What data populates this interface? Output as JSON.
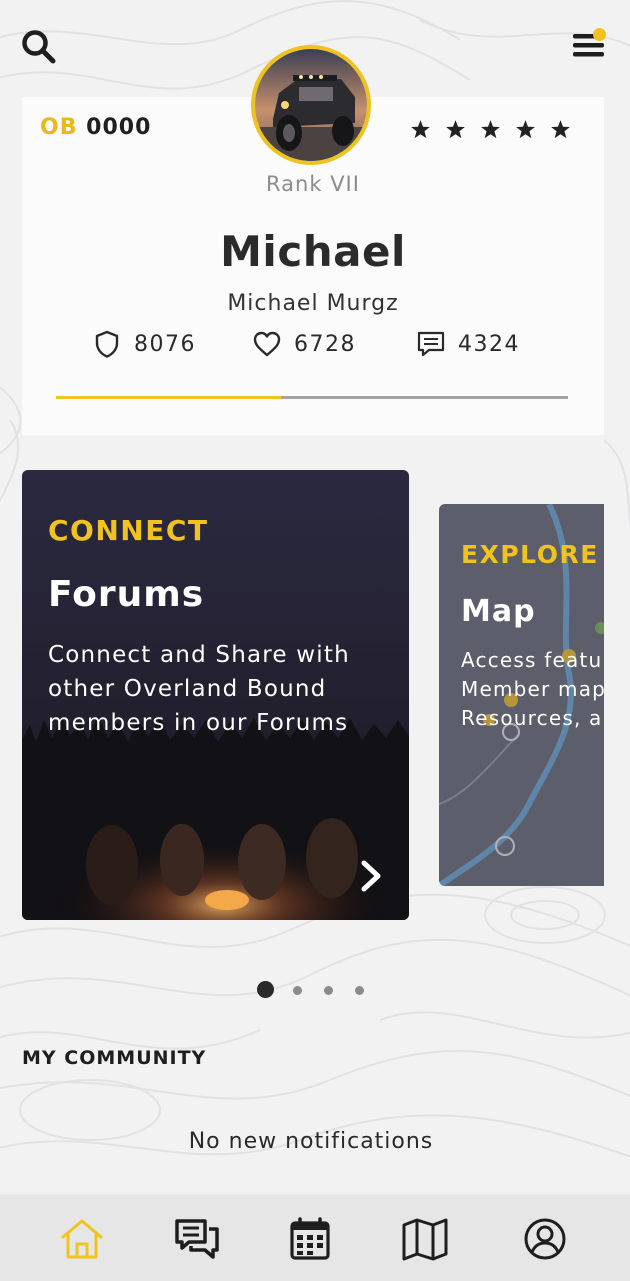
{
  "colors": {
    "accent": "#f0c31e",
    "text_primary": "#2b2b2b",
    "text_muted": "#8c8c8c",
    "card_surface": "#fbfbfb",
    "page_background": "#f2f2f3",
    "nav_background": "#e6e6e7"
  },
  "header": {
    "search_icon": "search-icon",
    "menu_icon": "hamburger-menu-icon",
    "has_notification": true
  },
  "profile": {
    "member_prefix": "OB",
    "member_number": "0000",
    "rating_stars": 5,
    "rank": "Rank VII",
    "display_name": "Michael",
    "full_name": "Michael Murgz",
    "stats": {
      "points": "8076",
      "likes": "6728",
      "comments": "4324"
    },
    "progress_fraction": 0.44
  },
  "carousel": {
    "cards": [
      {
        "eyebrow": "CONNECT",
        "title": "Forums",
        "description": "Connect and Share with other Overland Bound members in our Forums",
        "action_icon": "chevron-right-icon"
      },
      {
        "eyebrow": "EXPLORE",
        "title": "Map",
        "description_lines": [
          "Access featu",
          "Member map",
          "Resources, a"
        ]
      }
    ],
    "page_count": 4,
    "active_page": 1
  },
  "community": {
    "title": "MY COMMUNITY",
    "empty_message": "No new notifications"
  },
  "bottom_nav": {
    "items": [
      {
        "icon": "home-icon",
        "active": true
      },
      {
        "icon": "forums-icon",
        "active": false
      },
      {
        "icon": "calendar-icon",
        "active": false
      },
      {
        "icon": "map-icon",
        "active": false
      },
      {
        "icon": "profile-icon",
        "active": false
      }
    ]
  }
}
